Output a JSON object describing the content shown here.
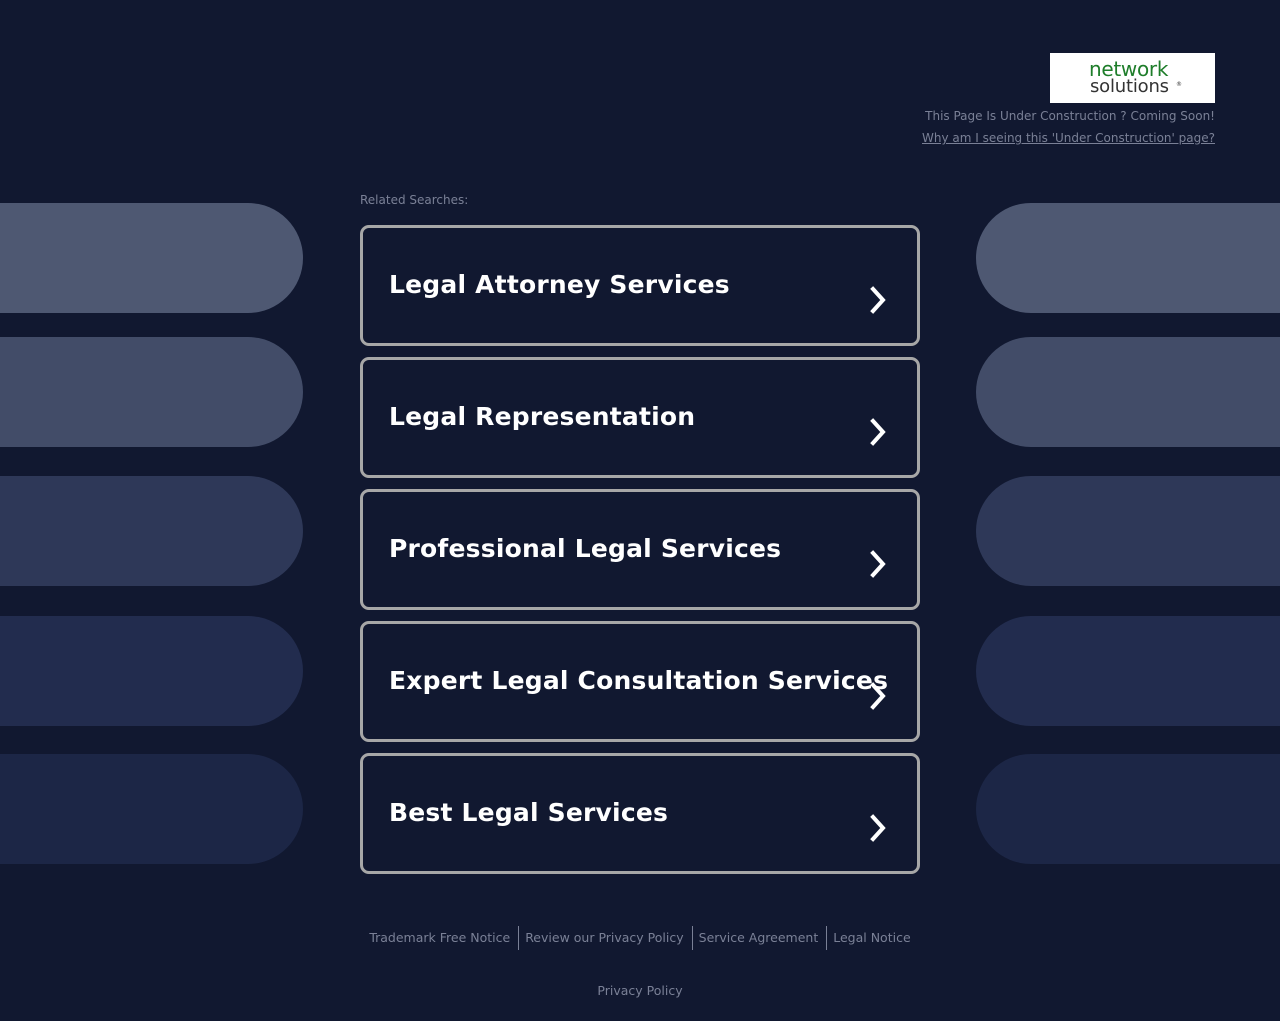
{
  "header": {
    "logo": {
      "line1": "network",
      "line2": "solutions",
      "registered": "®"
    },
    "notice": "This Page Is Under Construction ? Coming Soon!",
    "why_link": "Why am I seeing this 'Under Construction' page?"
  },
  "related": {
    "heading": "Related Searches:",
    "items": [
      {
        "label": "Legal Attorney Services"
      },
      {
        "label": "Legal Representation"
      },
      {
        "label": "Professional Legal Services"
      },
      {
        "label": "Expert Legal Consultation Services"
      },
      {
        "label": "Best Legal Services"
      }
    ]
  },
  "footer": {
    "links": [
      "Trademark Free Notice",
      "Review our Privacy Policy",
      "Service Agreement",
      "Legal Notice"
    ],
    "privacy": "Privacy Policy"
  },
  "colors": {
    "background": "#111830",
    "card_border": "#a7a7a7",
    "pill_row1": "#4e5872",
    "pill_row2": "#424c68",
    "pill_row3": "#2e3858",
    "pill_row4": "#222c4e",
    "pill_row5": "#1c2646",
    "logo_green": "#1e7d2a",
    "muted_text": "#7a8096"
  }
}
